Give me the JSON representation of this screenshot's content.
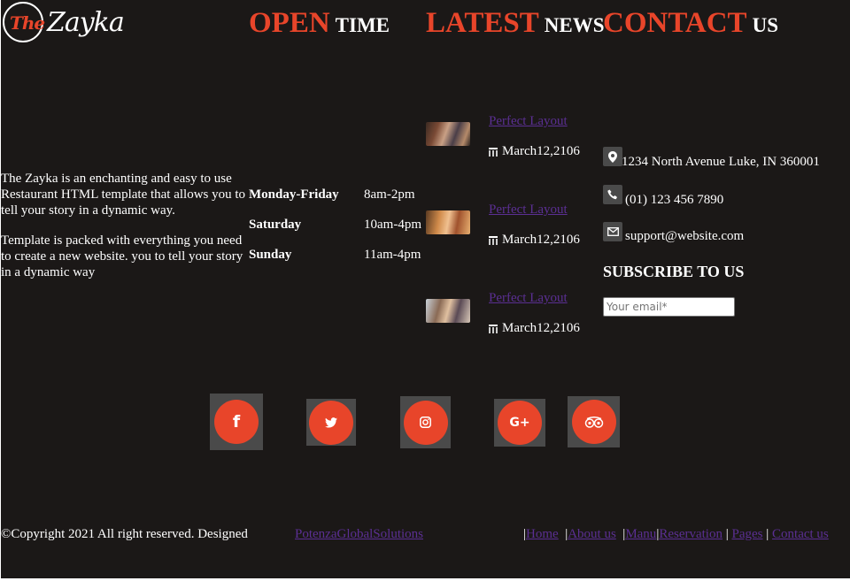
{
  "logo": {
    "part1": "The",
    "part2": "Zayka"
  },
  "headings": {
    "open": {
      "big": "OPEN",
      "small": "TIME"
    },
    "latest": {
      "big": "LATEST",
      "small": "NEWS"
    },
    "contact": {
      "big": "CONTACT",
      "small": "US"
    }
  },
  "about": {
    "p1": "The Zayka is an enchanting and easy to use Restaurant HTML template that allows you to tell your story in a dynamic way.",
    "p2": "Template is packed with everything you need to create a new website. you to tell your story in a dynamic way"
  },
  "hours": [
    {
      "day": "Monday-Friday",
      "time": "8am-2pm"
    },
    {
      "day": "Saturday",
      "time": "10am-4pm"
    },
    {
      "day": "Sunday",
      "time": "11am-4pm"
    }
  ],
  "news": [
    {
      "title": "Perfect Layout",
      "date": "March12,2106"
    },
    {
      "title": "Perfect Layout",
      "date": "March12,2106"
    },
    {
      "title": "Perfect Layout",
      "date": "March12,2106"
    }
  ],
  "contact": {
    "address": "1234 North Avenue Luke, IN 360001",
    "phone": "(01) 123 456 7890",
    "email": "support@website.com",
    "subscribe_title": "SUBSCRIBE TO US",
    "email_placeholder": "Your email*"
  },
  "social": {
    "facebook": "f",
    "twitter": "twitter-icon",
    "instagram": "instagram-icon",
    "google_plus": "G+",
    "tripadvisor": "tripadvisor-icon"
  },
  "footer": {
    "copyright": "©Copyright 2021 All right reserved. Designed",
    "designer": "PotenzaGlobalSolutions",
    "nav": [
      "Home",
      "About us",
      "Manu",
      "Reservation",
      "Pages",
      "Contact us"
    ]
  },
  "colors": {
    "accent": "#e8452a",
    "background": "#1b1817",
    "link": "#5b2f93"
  }
}
